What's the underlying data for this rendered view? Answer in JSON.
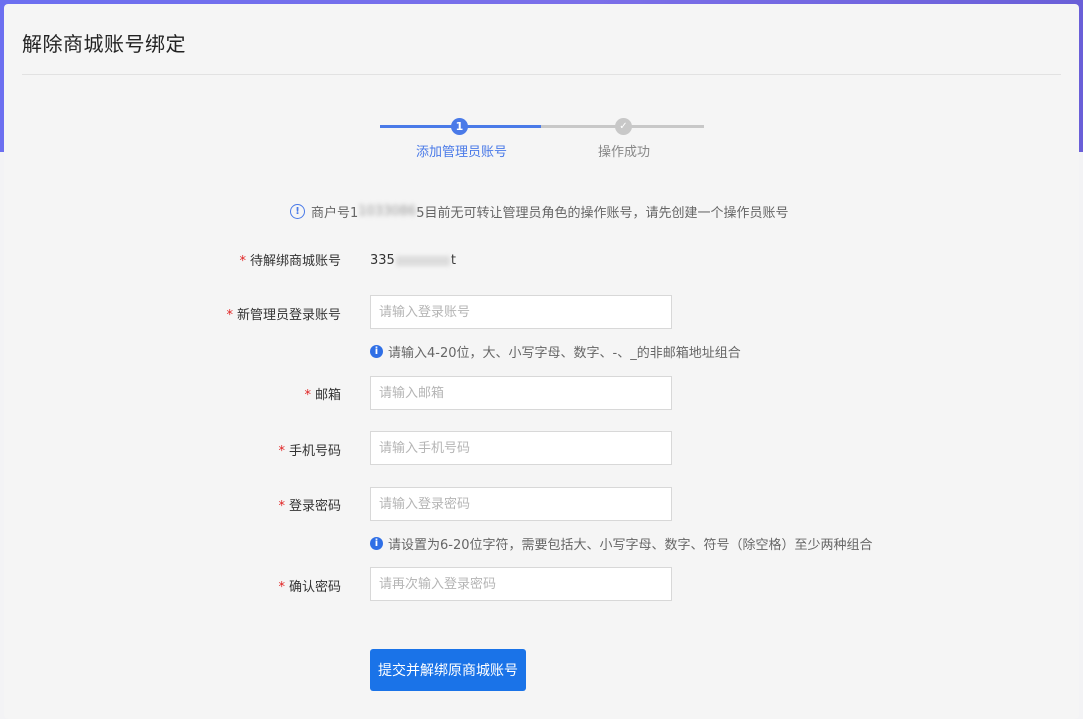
{
  "page": {
    "title": "解除商城账号绑定"
  },
  "steps": [
    {
      "index": "1",
      "label": "添加管理员账号",
      "state": "active"
    },
    {
      "index": "✓",
      "label": "操作成功",
      "state": "inactive"
    }
  ],
  "notice": {
    "icon": "info-outline-icon",
    "text_before": "商户号1",
    "text_redacted": "1033086",
    "text_after": "5目前无可转让管理员角色的操作账号，请先创建一个操作员账号"
  },
  "form": {
    "unbind_account": {
      "label": "待解绑商城账号",
      "value_start": "335",
      "value_end": "t"
    },
    "new_admin": {
      "label": "新管理员登录账号",
      "placeholder": "请输入登录账号",
      "hint": "请输入4-20位，大、小写字母、数字、-、_的非邮箱地址组合"
    },
    "email": {
      "label": "邮箱",
      "placeholder": "请输入邮箱"
    },
    "phone": {
      "label": "手机号码",
      "placeholder": "请输入手机号码"
    },
    "password": {
      "label": "登录密码",
      "placeholder": "请输入登录密码",
      "hint": "请设置为6-20位字符，需要包括大、小写字母、数字、符号（除空格）至少两种组合"
    },
    "confirm_password": {
      "label": "确认密码",
      "placeholder": "请再次输入登录密码"
    },
    "required_mark": "*"
  },
  "submit": {
    "label": "提交并解绑原商城账号"
  },
  "colors": {
    "accent": "#4a7ae8",
    "button": "#1a73e8",
    "required": "#e02020"
  }
}
